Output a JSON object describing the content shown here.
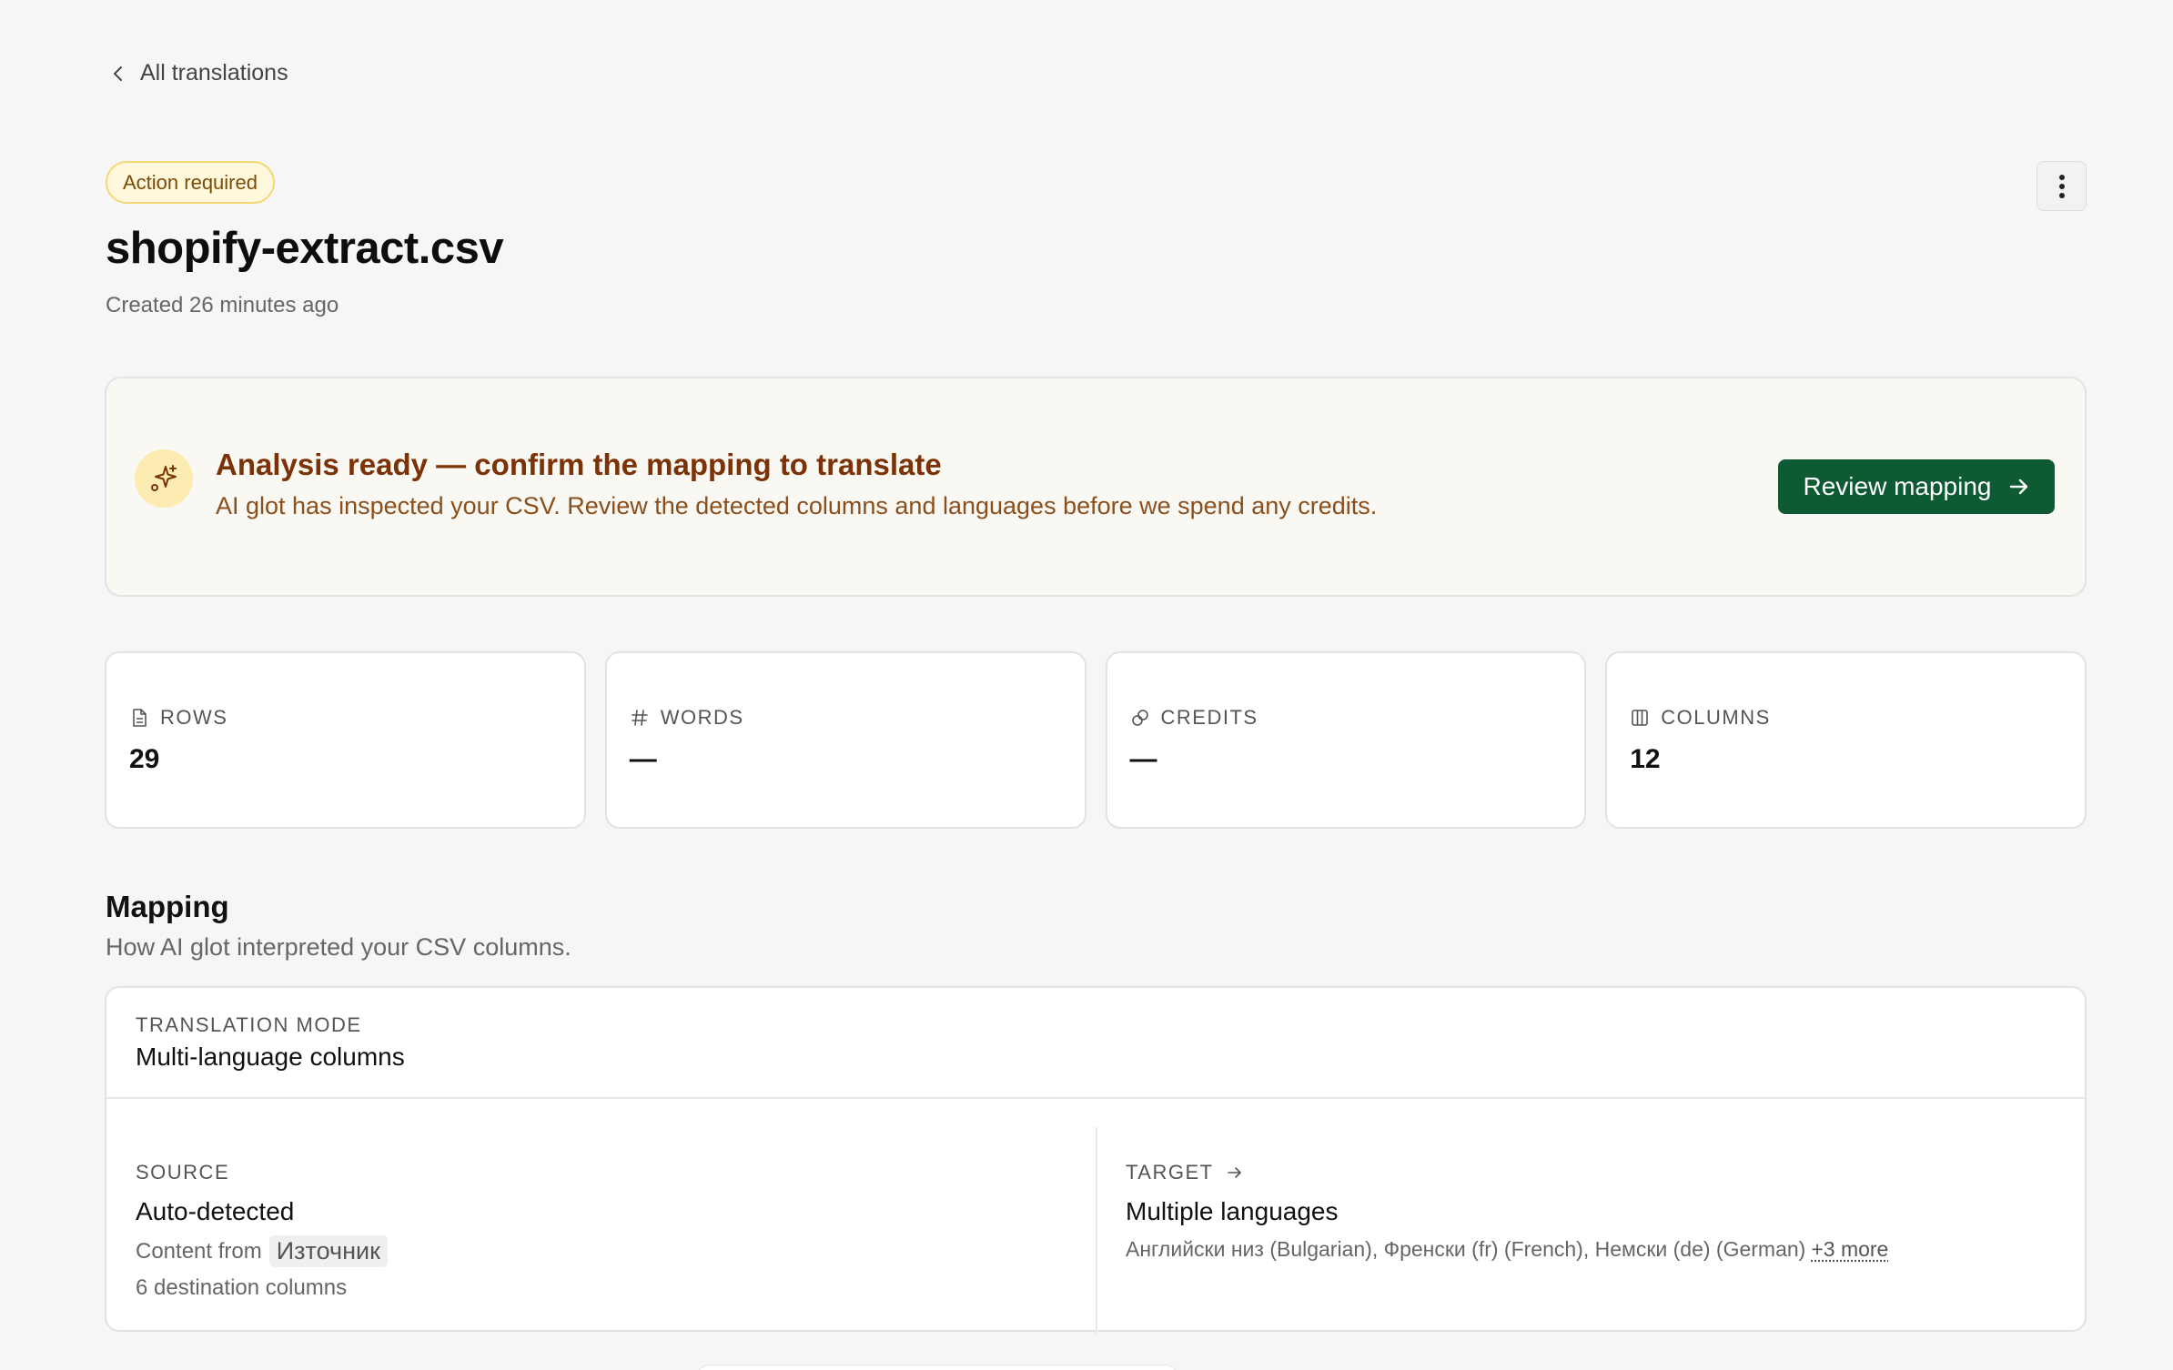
{
  "nav": {
    "back_label": "All translations"
  },
  "header": {
    "badge": "Action required",
    "title": "shopify-extract.csv",
    "created": "Created 26 minutes ago"
  },
  "banner": {
    "title": "Analysis ready — confirm the mapping to translate",
    "text": "AI glot has inspected your CSV. Review the detected columns and languages before we spend any credits.",
    "button_label": "Review mapping"
  },
  "stats": [
    {
      "label": "ROWS",
      "value": "29",
      "icon": "file-icon"
    },
    {
      "label": "WORDS",
      "value": "—",
      "icon": "hash-icon"
    },
    {
      "label": "CREDITS",
      "value": "—",
      "icon": "coins-icon"
    },
    {
      "label": "COLUMNS",
      "value": "12",
      "icon": "columns-icon"
    }
  ],
  "mapping": {
    "title": "Mapping",
    "subtitle": "How AI glot interpreted your CSV columns.",
    "mode_label": "TRANSLATION MODE",
    "mode_value": "Multi-language columns",
    "source": {
      "label": "SOURCE",
      "value": "Auto-detected",
      "content_prefix": "Content from",
      "content_chip": "Източник",
      "destination": "6 destination columns"
    },
    "target": {
      "label": "TARGET",
      "value": "Multiple languages",
      "languages": "Английски низ (Bulgarian), Френски (fr) (French), Немски (de) (German)",
      "more": "+3 more"
    }
  },
  "colors": {
    "accent_button": "#0e5a33",
    "banner_title": "#7a3206",
    "badge_border": "#f5d77a",
    "badge_bg": "#fff8dc"
  }
}
